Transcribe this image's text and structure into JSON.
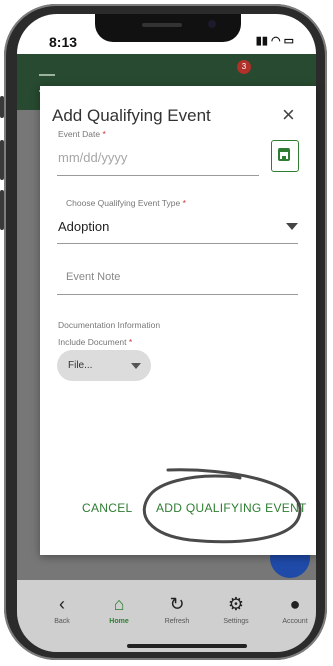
{
  "status_bar": {
    "time": "8:13",
    "signal_icons": "signal-wifi-battery-icons"
  },
  "app_bar": {
    "notification_count": "3"
  },
  "dialog": {
    "title": "Add Qualifying Event",
    "close_icon": "×",
    "event_date": {
      "label": "Event Date",
      "required_mark": "*",
      "placeholder": "mm/dd/yyyy"
    },
    "event_type": {
      "label": "Choose Qualifying Event Type",
      "required_mark": "*",
      "value": "Adoption"
    },
    "event_note": {
      "placeholder": "Event Note"
    },
    "documentation": {
      "section_label": "Documentation Information",
      "include_label": "Include Document",
      "required_mark": "*",
      "file_value": "File..."
    },
    "cancel_label": "CANCEL",
    "submit_label": "ADD QUALIFYING EVENT"
  },
  "bottom_nav": [
    {
      "label": "Back",
      "icon": "‹"
    },
    {
      "label": "Home",
      "icon": "⌂"
    },
    {
      "label": "Refresh",
      "icon": "↻"
    },
    {
      "label": "Settings",
      "icon": "⚙"
    },
    {
      "label": "Account",
      "icon": "●"
    }
  ],
  "colors": {
    "accent_green": "#2e7d32",
    "appbar_green": "#274a30",
    "required_red": "#d32f2f"
  }
}
